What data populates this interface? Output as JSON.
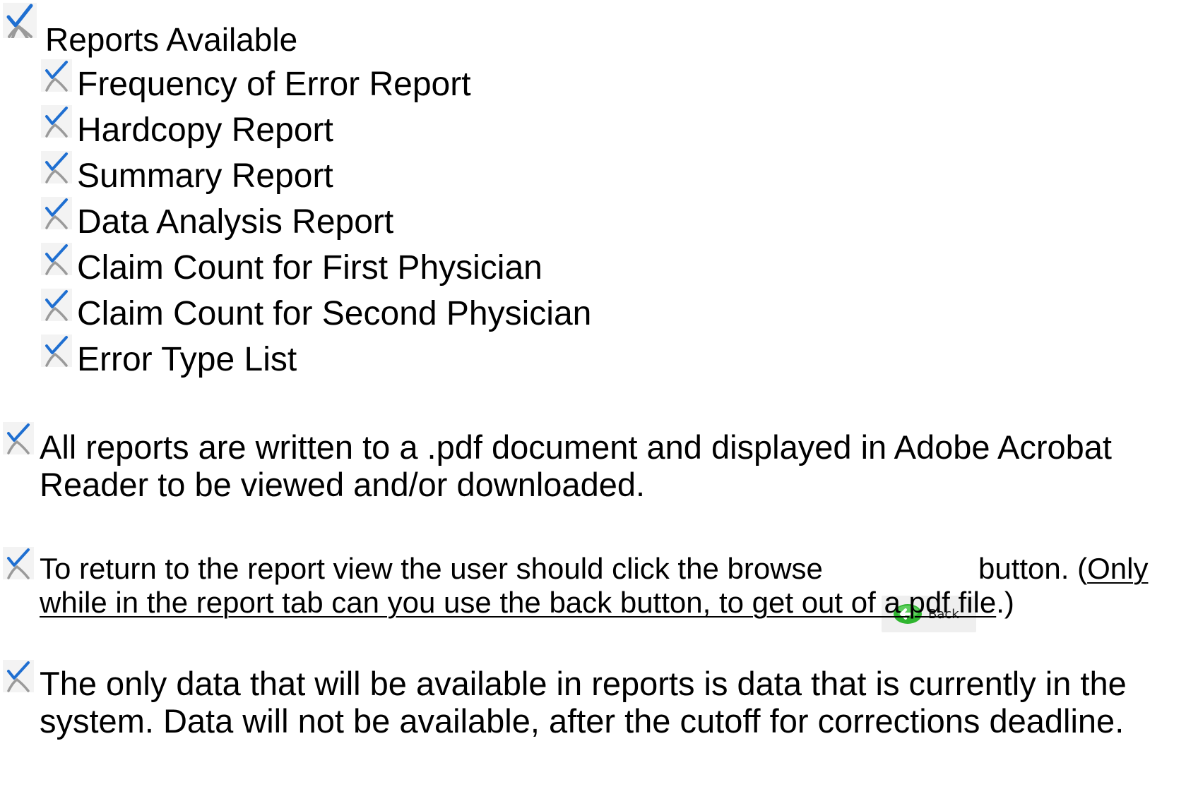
{
  "heading": {
    "text": "Reports Available"
  },
  "reports": [
    "Frequency of Error Report",
    "Hardcopy Report",
    "Summary Report",
    "Data Analysis Report",
    "Claim Count for First Physician",
    "Claim Count for Second Physician",
    "Error Type List"
  ],
  "para1": {
    "line1": "All reports are written to a .pdf document and displayed in Adobe Acrobat",
    "line2": "Reader to be viewed and/or downloaded."
  },
  "para2": {
    "before_button": "To return to the report view the user should click the browse",
    "after_button": "button.  (",
    "underlined_1": "Only",
    "underlined_2": "while in the report tab can you use the  back  button,  to get out of a pdf file",
    "tail": ".)"
  },
  "back_button": {
    "label": "Back",
    "icon": "back-arrow-icon"
  },
  "para3": {
    "line1": "The only data that will be available in reports is data that is currently in the",
    "line2": "system.  Data will not be available, after the cutoff for corrections deadline."
  },
  "colors": {
    "check_blue": "#1f6fd1",
    "stick_gray": "#9a9a9a",
    "back_green": "#2fb52f"
  },
  "icons": {
    "bullet": "checkmark-figure-icon"
  }
}
